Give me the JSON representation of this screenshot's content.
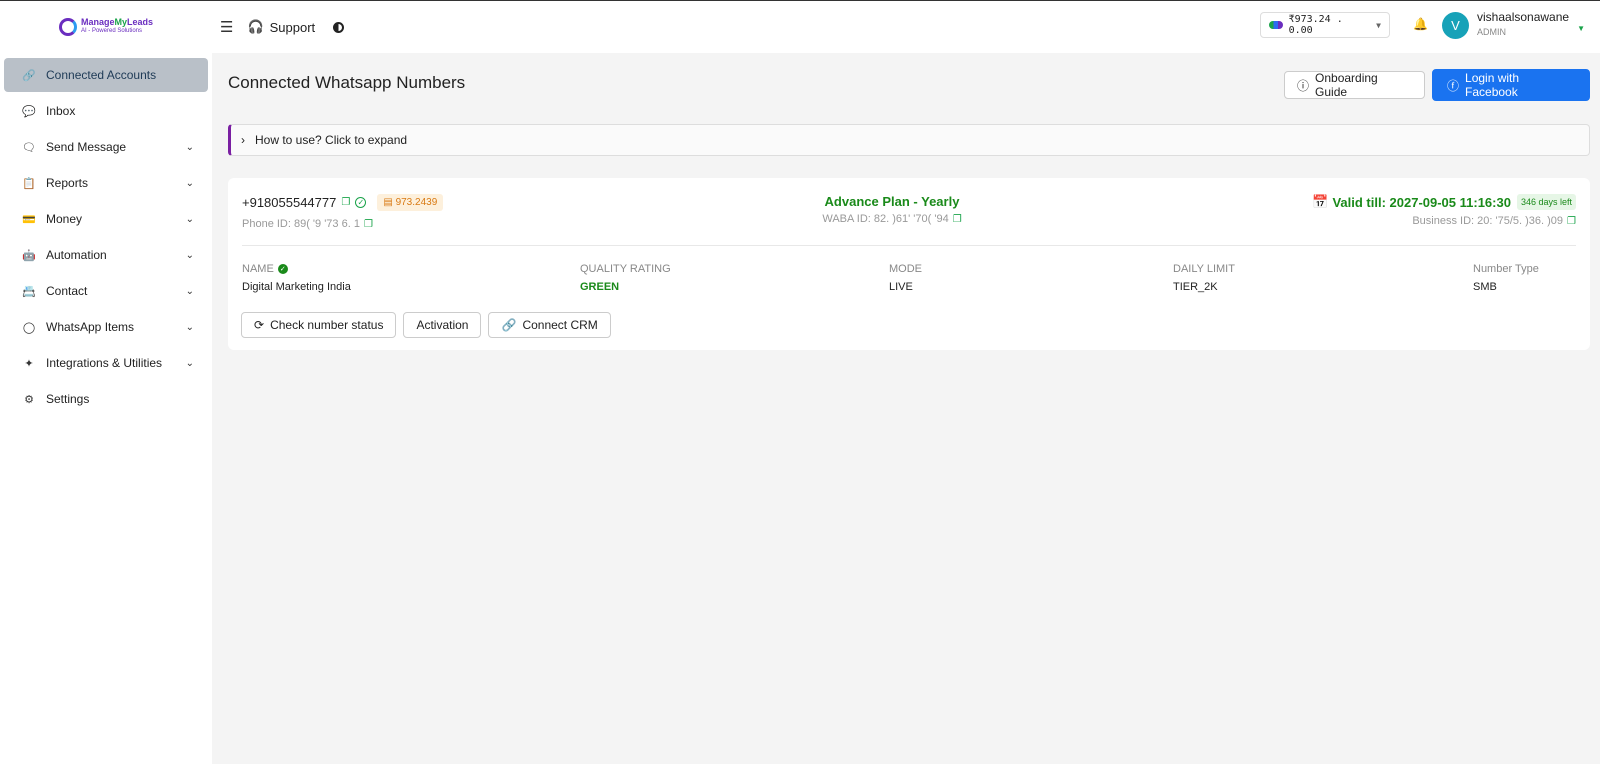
{
  "header": {
    "logo_name_part1": "Manage",
    "logo_name_part2": "My",
    "logo_name_part3": "Leads",
    "logo_tagline": "AI - Powered Solutions",
    "support_label": "Support",
    "wallet_text": "₹973.24 . 0.00",
    "user_initial": "V",
    "user_name": "vishaalsonawane",
    "user_role": "ADMIN"
  },
  "sidebar": {
    "items": [
      {
        "label": "Connected Accounts",
        "icon": "link-icon",
        "glyph": "🔗",
        "has_children": false
      },
      {
        "label": "Inbox",
        "icon": "chat-icon",
        "glyph": "💬",
        "has_children": false
      },
      {
        "label": "Send Message",
        "icon": "message-icon",
        "glyph": "🗨",
        "has_children": true
      },
      {
        "label": "Reports",
        "icon": "report-icon",
        "glyph": "📋",
        "has_children": true
      },
      {
        "label": "Money",
        "icon": "wallet-icon",
        "glyph": "💳",
        "has_children": true
      },
      {
        "label": "Automation",
        "icon": "robot-icon",
        "glyph": "🤖",
        "has_children": true
      },
      {
        "label": "Contact",
        "icon": "contact-icon",
        "glyph": "📇",
        "has_children": true
      },
      {
        "label": "WhatsApp Items",
        "icon": "whatsapp-icon",
        "glyph": "◯",
        "has_children": true
      },
      {
        "label": "Integrations & Utilities",
        "icon": "sparkle-icon",
        "glyph": "✦",
        "has_children": true
      },
      {
        "label": "Settings",
        "icon": "gear-icon",
        "glyph": "⚙",
        "has_children": false
      }
    ]
  },
  "main": {
    "title": "Connected Whatsapp Numbers",
    "onboarding_label": "Onboarding Guide",
    "facebook_label": "Login with Facebook",
    "howto_label": "How to use? Click to expand",
    "account": {
      "phone": "+918055544777",
      "balance": "973.2439",
      "phone_id": "Phone ID: 89( '9 '73 6. 1",
      "plan": "Advance Plan - Yearly",
      "waba_id": "WABA ID: 82. )61' '70( '94",
      "valid_till": "Valid till: 2027-09-05 11:16:30",
      "days_left": "346 days left",
      "business_id": "Business ID: 20: '75/5. )36. )09",
      "name_label": "NAME",
      "name_value": "Digital Marketing India",
      "quality_label": "QUALITY RATING",
      "quality_value": "GREEN",
      "mode_label": "MODE",
      "mode_value": "LIVE",
      "limit_label": "DAILY LIMIT",
      "limit_value": "TIER_2K",
      "type_label": "Number Type",
      "type_value": "SMB"
    },
    "actions": {
      "check_status": "Check number status",
      "activation": "Activation",
      "connect_crm": "Connect CRM"
    }
  }
}
